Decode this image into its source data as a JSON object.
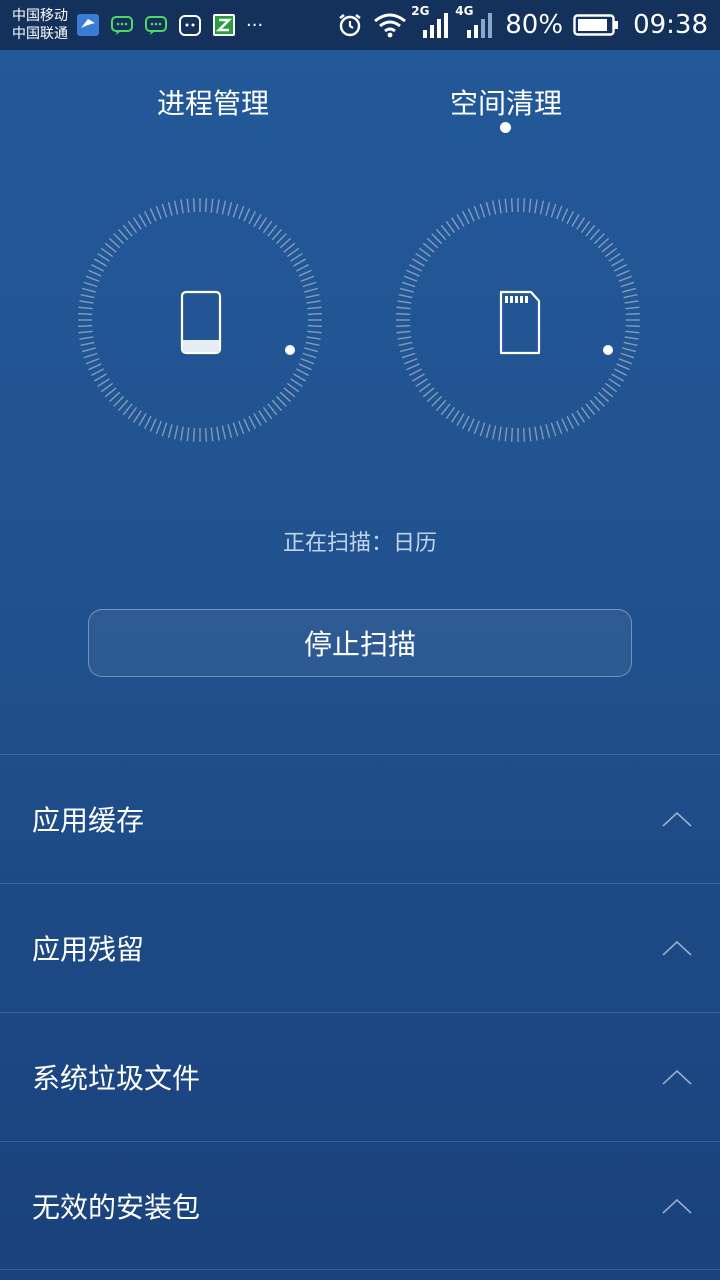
{
  "status_bar": {
    "carrier_1": "中国移动",
    "carrier_2": "中国联通",
    "network_1": "2G",
    "network_2": "4G",
    "battery": "80%",
    "time": "09:38",
    "more": "···",
    "icons": [
      "bird-app-icon",
      "message-icon",
      "message-icon",
      "cat-app-icon",
      "z-app-icon",
      "alarm-icon",
      "wifi-icon",
      "signal-icon",
      "battery-icon"
    ]
  },
  "tabs": [
    {
      "label": "进程管理",
      "active": false
    },
    {
      "label": "空间清理",
      "active": true
    }
  ],
  "dials": [
    {
      "icon": "phone-icon"
    },
    {
      "icon": "sd-card-icon"
    }
  ],
  "scan": {
    "status_text": "正在扫描：日历"
  },
  "actions": {
    "stop_label": "停止扫描"
  },
  "list": [
    {
      "label": "应用缓存",
      "icon": "chevron-up-icon"
    },
    {
      "label": "应用残留",
      "icon": "chevron-up-icon"
    },
    {
      "label": "系统垃圾文件",
      "icon": "chevron-up-icon"
    },
    {
      "label": "无效的安装包",
      "icon": "chevron-up-icon"
    }
  ],
  "colors": {
    "background_top": "#23599a",
    "background_bottom": "#1a427c",
    "status_bar": "#14315c",
    "secondary_text": "#c4d4ea"
  }
}
